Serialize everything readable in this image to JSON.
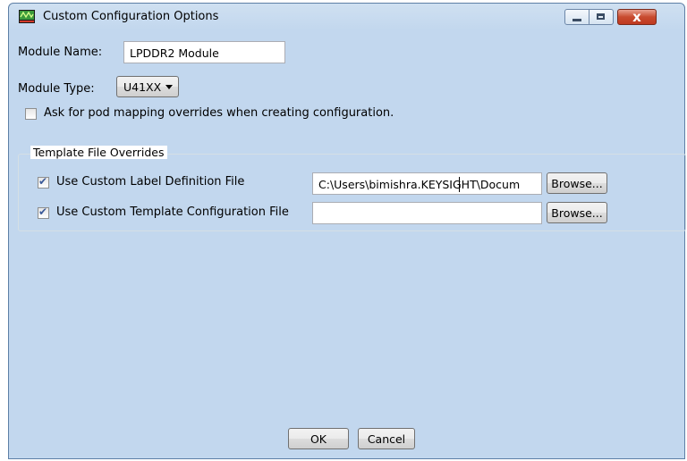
{
  "window": {
    "title": "Custom Configuration Options",
    "icon": "oscilloscope-app-icon",
    "controls": {
      "minimize_icon": "minimize-icon",
      "maximize_icon": "maximize-icon",
      "close_icon": "close-icon",
      "close_glyph": "x"
    }
  },
  "module_name": {
    "label": "Module Name:",
    "value": "LPDDR2 Module"
  },
  "module_type": {
    "label": "Module Type:",
    "selected": "U41XX"
  },
  "pod_mapping": {
    "label": "Ask for pod mapping overrides when creating configuration.",
    "checked": false
  },
  "template_overrides": {
    "legend": "Template File Overrides",
    "label_definition": {
      "label": "Use Custom Label Definition File",
      "checked": true,
      "value": "C:\\Users\\bimishra.KEYSIGHT\\Docum",
      "browse_label": "Browse..."
    },
    "template_configuration": {
      "label": "Use Custom Template Configuration File",
      "checked": true,
      "value": "",
      "browse_label": "Browse..."
    }
  },
  "footer": {
    "ok_label": "OK",
    "cancel_label": "Cancel"
  },
  "colors": {
    "title_bar": "#c2d7ee",
    "close_button": "#c84b2f",
    "check_mark": "#3b5a99"
  }
}
